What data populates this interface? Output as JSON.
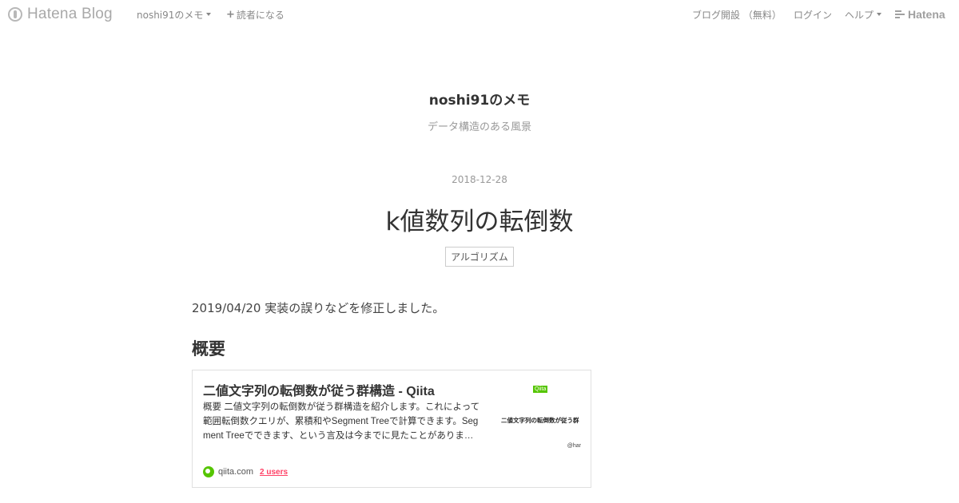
{
  "topbar": {
    "logo_text": "Hatena Blog",
    "blog_menu_label": "noshi91のメモ",
    "subscribe_label": "読者になる",
    "open_blog_label": "ブログ開設 （無料）",
    "login_label": "ログイン",
    "help_label": "ヘルプ",
    "brand_label": "Hatena"
  },
  "blog": {
    "title": "noshi91のメモ",
    "description": "データ構造のある風景"
  },
  "entry": {
    "date": "2018-12-28",
    "title": "k値数列の転倒数",
    "category": "アルゴリズム",
    "intro": "2019/04/20 実装の誤りなどを修正しました。",
    "section_heading": "概要"
  },
  "embed": {
    "title": "二値文字列の転倒数が従う群構造 - Qiita",
    "description_lines": [
      "概要 二値文字列の転倒数が従う群構造を紹介します。これによって",
      "範囲転倒数クエリが、累積和やSegment Treeで計算できます。Seg",
      "ment Treeでできます、という言及は今までに見たことがありま…"
    ],
    "thumb_badge": "Qiita",
    "thumb_text": "二値文字列の転倒数が従う群",
    "thumb_handle": "@har",
    "domain": "qiita.com",
    "users": "2 users"
  },
  "colors": {
    "accent_users": "#ff4166",
    "qiita_green": "#55c500"
  }
}
